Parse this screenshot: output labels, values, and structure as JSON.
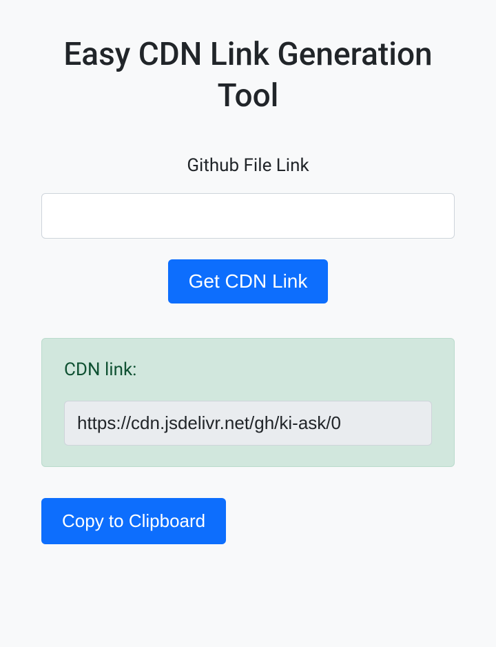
{
  "page": {
    "title": "Easy CDN Link Generation Tool"
  },
  "form": {
    "input_label": "Github File Link",
    "input_value": "",
    "submit_label": "Get CDN Link"
  },
  "result": {
    "heading": "CDN link:",
    "cdn_url": "https://cdn.jsdelivr.net/gh/ki-ask/0"
  },
  "actions": {
    "copy_label": "Copy to Clipboard"
  }
}
